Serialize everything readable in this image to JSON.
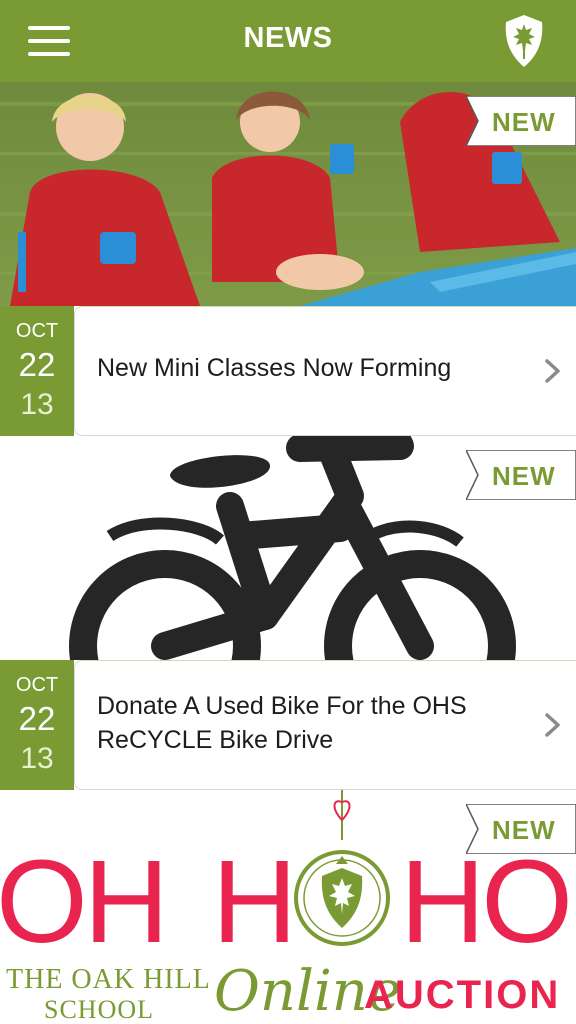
{
  "header": {
    "title": "NEWS",
    "menu_icon": "hamburger-icon",
    "logo_icon": "oak-leaf-shield-logo"
  },
  "feed": [
    {
      "badge": "NEW",
      "date": {
        "month": "OCT",
        "day": "22",
        "year": "13"
      },
      "headline": "New Mini Classes Now Forming"
    },
    {
      "badge": "NEW",
      "date": {
        "month": "OCT",
        "day": "22",
        "year": "13"
      },
      "headline": "Donate A Used Bike For the OHS ReCYCLE Bike Drive"
    },
    {
      "badge": "NEW",
      "image_text": {
        "line1_left": "OH",
        "line1_mid": "H",
        "line1_right": "HO",
        "school_line1": "THE OAK HILL",
        "school_line2": "SCHOOL",
        "online": "Online",
        "auction": "AUCTION"
      }
    }
  ],
  "colors": {
    "brand_green": "#7a9a33",
    "auction_red": "#e8244f",
    "headline_text": "#1d1d1d"
  }
}
